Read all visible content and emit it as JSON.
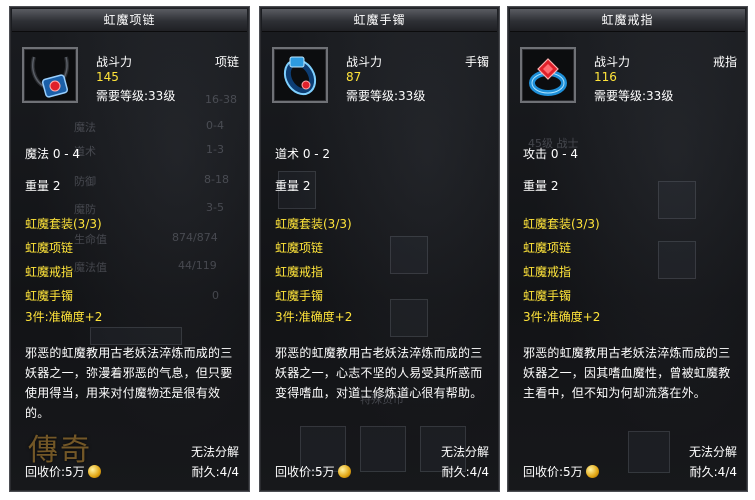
{
  "panels": [
    {
      "title": "虹魔项链",
      "stat_label": "战斗力",
      "stat_value": "145",
      "level": "需要等级:33级",
      "item_type": "项链",
      "attribute": "魔法 0 - 4",
      "weight": "重量 2",
      "set_name": "虹魔套装(3/3)",
      "set_items": [
        "虹魔项链",
        "虹魔戒指",
        "虹魔手镯"
      ],
      "set_bonus": "3件:准确度+2",
      "description": "邪恶的虹魔教用古老妖法淬炼而成的三妖器之一，弥漫着邪恶的气息，但只要使用得当，用来对付魔物还是很有效的。",
      "no_split": "无法分解",
      "durability": "耐久:4/4",
      "recycle": "回收价:5万",
      "bg_logo": "傳奇",
      "icon": "necklace-icon",
      "bg_labels": [
        "16-38",
        "魔法",
        "0-4",
        "道术",
        "1-3",
        "防御",
        "8-18",
        "魔防",
        "3-5",
        "生命值",
        "874/874",
        "魔法值",
        "44/119",
        "0"
      ]
    },
    {
      "title": "虹魔手镯",
      "stat_label": "战斗力",
      "stat_value": "87",
      "level": "需要等级:33级",
      "item_type": "手镯",
      "attribute": "道术 0 - 2",
      "weight": "重量 2",
      "set_name": "虹魔套装(3/3)",
      "set_items": [
        "虹魔项链",
        "虹魔戒指",
        "虹魔手镯"
      ],
      "set_bonus": "3件:准确度+2",
      "description": "邪恶的虹魔教用古老妖法淬炼而成的三妖器之一，心志不坚的人易受其所惑而变得嗜血，对道士修炼道心很有帮助。",
      "no_split": "无法分解",
      "durability": "耐久:4/4",
      "recycle": "回收价:5万",
      "icon": "bracelet-icon",
      "bg_labels": [
        "特殊货币"
      ]
    },
    {
      "title": "虹魔戒指",
      "stat_label": "战斗力",
      "stat_value": "116",
      "level": "需要等级:33级",
      "item_type": "戒指",
      "attribute": "攻击 0 - 4",
      "weight": "重量 2",
      "set_name": "虹魔套装(3/3)",
      "set_items": [
        "虹魔项链",
        "虹魔戒指",
        "虹魔手镯"
      ],
      "set_bonus": "3件:准确度+2",
      "description": "邪恶的虹魔教用古老妖法淬炼而成的三妖器之一，因其嗜血魔性，曾被虹魔教主看中，但不知为何却流落在外。",
      "no_split": "无法分解",
      "durability": "耐久:4/4",
      "recycle": "回收价:5万",
      "icon": "ring-icon",
      "bg_labels": [
        "45级 战士"
      ]
    }
  ],
  "colors": {
    "gold_text": "#ffe43a",
    "white_text": "#ffffff",
    "panel_bg": "#141518",
    "gem_red": "#e0202a",
    "band_blue": "#1e8fd8"
  }
}
